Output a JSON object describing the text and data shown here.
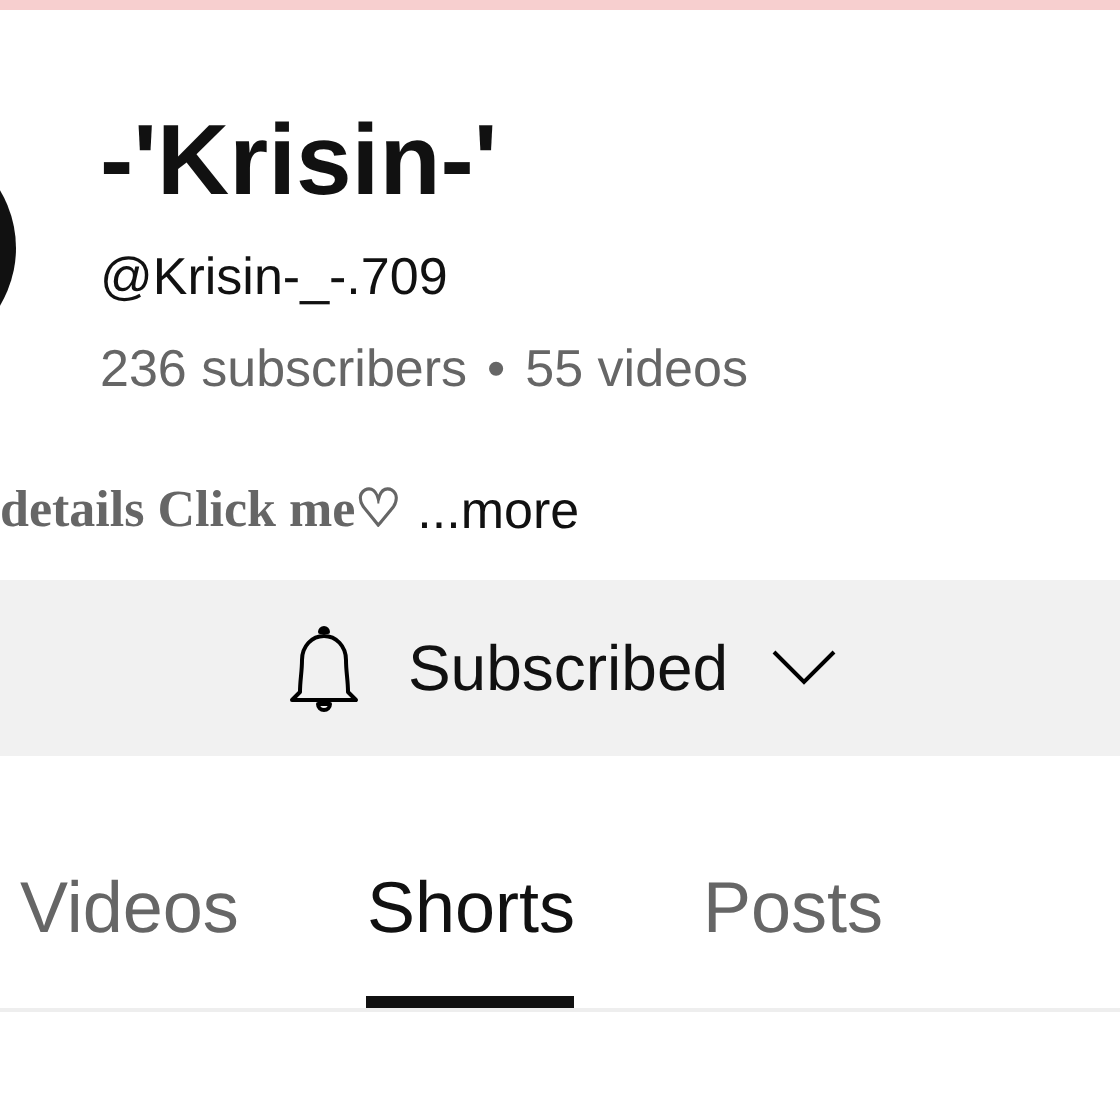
{
  "channel": {
    "name": "-'Krisin-'",
    "handle": "@Krisin-_-.709",
    "subscribers": "236 subscribers",
    "separator": "•",
    "videos": "55 videos"
  },
  "description": {
    "text": "details Click me♡",
    "more": "...more"
  },
  "subscribe_button": {
    "label": "Subscribed",
    "subscribed": true
  },
  "tabs": [
    {
      "label": "Videos",
      "selected": false
    },
    {
      "label": "Shorts",
      "selected": true
    },
    {
      "label": "Posts",
      "selected": false
    }
  ]
}
